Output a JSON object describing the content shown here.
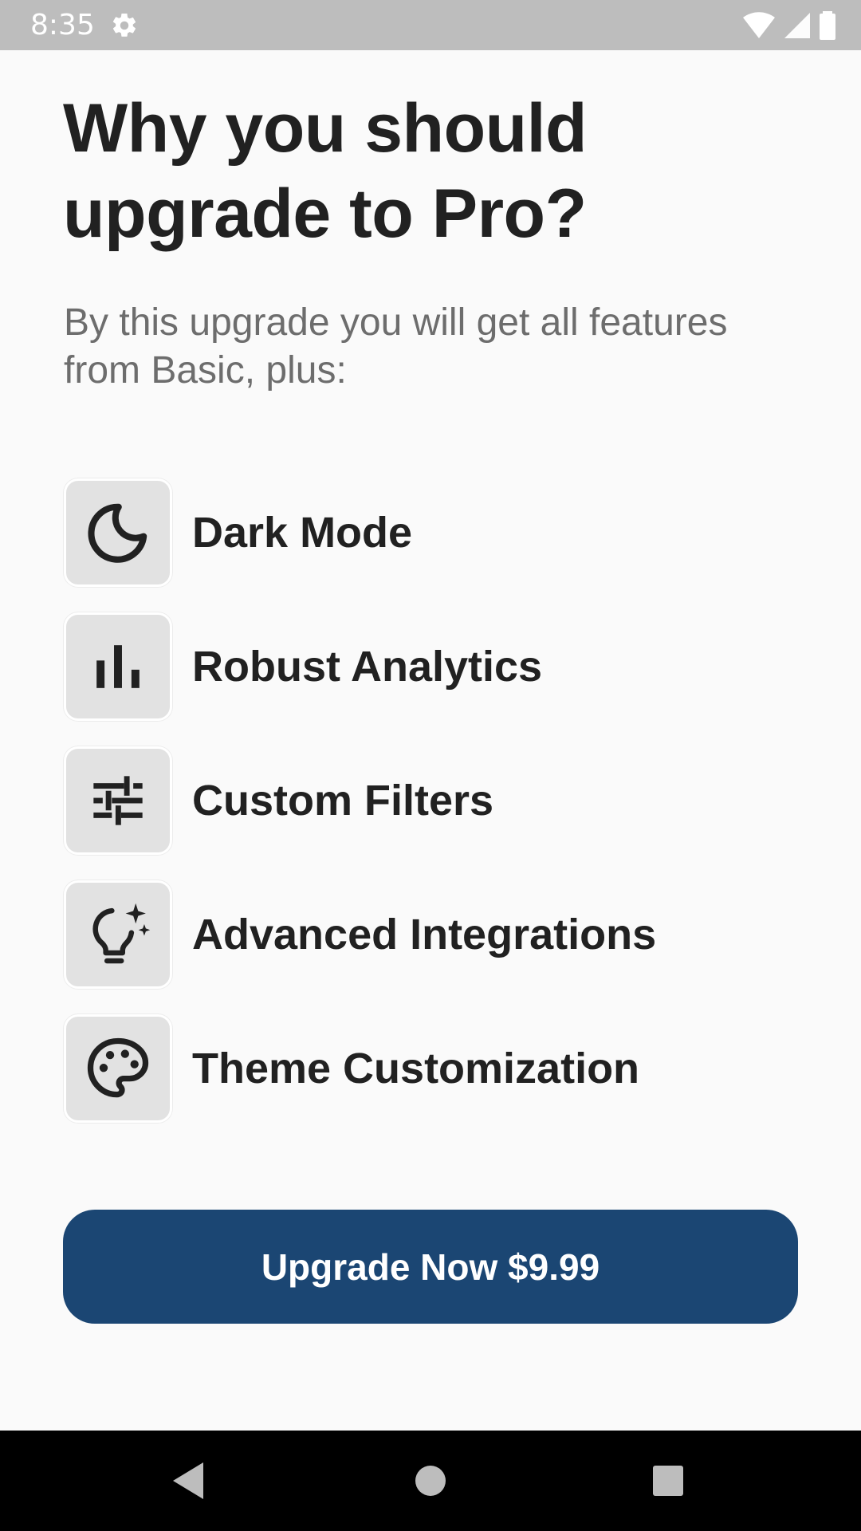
{
  "status_bar": {
    "time": "8:35",
    "icons": [
      "settings-icon",
      "wifi-icon",
      "cellular-icon",
      "battery-icon"
    ],
    "background": "#bdbdbd"
  },
  "header": {
    "title": "Why you should upgrade to Pro?",
    "subtitle": "By this upgrade you will get all features from Basic, plus:"
  },
  "features": [
    {
      "label": "Dark Mode",
      "icon": "moon-icon"
    },
    {
      "label": "Robust Analytics",
      "icon": "bar-chart-icon"
    },
    {
      "label": "Custom Filters",
      "icon": "sliders-icon"
    },
    {
      "label": "Advanced Integrations",
      "icon": "lightbulb-sparkle-icon"
    },
    {
      "label": "Theme Customization",
      "icon": "palette-icon"
    }
  ],
  "cta": {
    "label": "Upgrade Now $9.99",
    "color": "#1b4673"
  },
  "nav_bar": {
    "buttons": [
      "back-icon",
      "home-icon",
      "recents-icon"
    ]
  }
}
